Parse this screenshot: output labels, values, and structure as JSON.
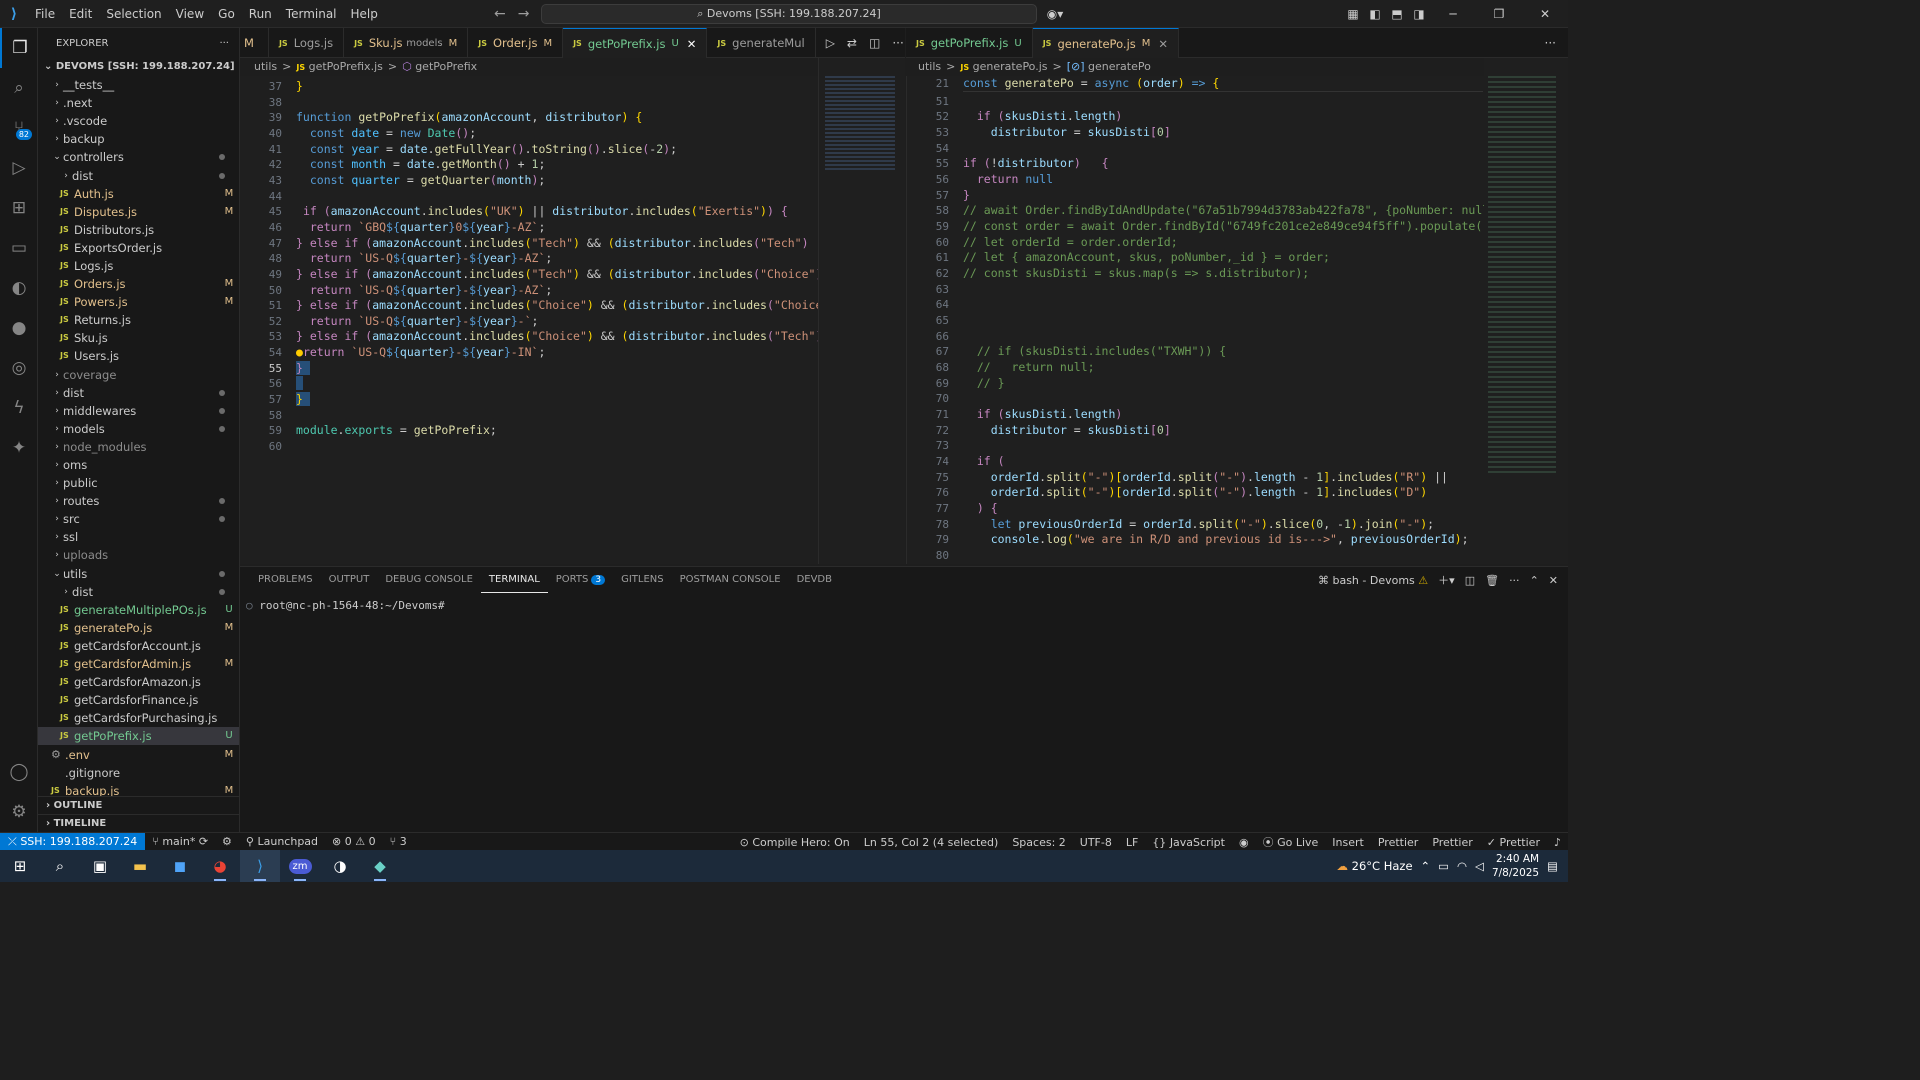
{
  "titlebar": {
    "menu": [
      "File",
      "Edit",
      "Selection",
      "View",
      "Go",
      "Run",
      "Terminal",
      "Help"
    ],
    "command_center": "Devoms [SSH: 199.188.207.24]"
  },
  "activity": {
    "scm_badge": "82"
  },
  "explorer": {
    "title": "EXPLORER",
    "root": "DEVOMS [SSH: 199.188.207.24]",
    "items": [
      {
        "name": "__tests__",
        "type": "folder",
        "indent": 1,
        "open": false,
        "status": ""
      },
      {
        "name": ".next",
        "type": "folder",
        "indent": 1,
        "open": false,
        "status": ""
      },
      {
        "name": ".vscode",
        "type": "folder",
        "indent": 1,
        "open": false,
        "status": ""
      },
      {
        "name": "backup",
        "type": "folder",
        "indent": 1,
        "open": false,
        "status": ""
      },
      {
        "name": "controllers",
        "type": "folder",
        "indent": 1,
        "open": true,
        "status": "dot"
      },
      {
        "name": "dist",
        "type": "folder",
        "indent": 2,
        "open": false,
        "status": "dot"
      },
      {
        "name": "Auth.js",
        "type": "js",
        "indent": 2,
        "status": "M"
      },
      {
        "name": "Disputes.js",
        "type": "js",
        "indent": 2,
        "status": "M"
      },
      {
        "name": "Distributors.js",
        "type": "js",
        "indent": 2,
        "status": ""
      },
      {
        "name": "ExportsOrder.js",
        "type": "js",
        "indent": 2,
        "status": ""
      },
      {
        "name": "Logs.js",
        "type": "js",
        "indent": 2,
        "status": ""
      },
      {
        "name": "Orders.js",
        "type": "js",
        "indent": 2,
        "status": "M"
      },
      {
        "name": "Powers.js",
        "type": "js",
        "indent": 2,
        "status": "M"
      },
      {
        "name": "Returns.js",
        "type": "js",
        "indent": 2,
        "status": ""
      },
      {
        "name": "Sku.js",
        "type": "js",
        "indent": 2,
        "status": ""
      },
      {
        "name": "Users.js",
        "type": "js",
        "indent": 2,
        "status": ""
      },
      {
        "name": "coverage",
        "type": "folder",
        "indent": 1,
        "open": false,
        "status": "",
        "dim": true
      },
      {
        "name": "dist",
        "type": "folder",
        "indent": 1,
        "open": false,
        "status": "dot"
      },
      {
        "name": "middlewares",
        "type": "folder",
        "indent": 1,
        "open": false,
        "status": "dot"
      },
      {
        "name": "models",
        "type": "folder",
        "indent": 1,
        "open": false,
        "status": "dot"
      },
      {
        "name": "node_modules",
        "type": "folder",
        "indent": 1,
        "open": false,
        "status": "",
        "dim": true
      },
      {
        "name": "oms",
        "type": "folder",
        "indent": 1,
        "open": false,
        "status": ""
      },
      {
        "name": "public",
        "type": "folder",
        "indent": 1,
        "open": false,
        "status": ""
      },
      {
        "name": "routes",
        "type": "folder",
        "indent": 1,
        "open": false,
        "status": "dot"
      },
      {
        "name": "src",
        "type": "folder",
        "indent": 1,
        "open": false,
        "status": "dot"
      },
      {
        "name": "ssl",
        "type": "folder",
        "indent": 1,
        "open": false,
        "status": ""
      },
      {
        "name": "uploads",
        "type": "folder",
        "indent": 1,
        "open": false,
        "status": "",
        "dim": true
      },
      {
        "name": "utils",
        "type": "folder",
        "indent": 1,
        "open": true,
        "status": "dot"
      },
      {
        "name": "dist",
        "type": "folder",
        "indent": 2,
        "open": false,
        "status": "dot"
      },
      {
        "name": "generateMultiplePOs.js",
        "type": "js",
        "indent": 2,
        "status": "U"
      },
      {
        "name": "generatePo.js",
        "type": "js",
        "indent": 2,
        "status": "M"
      },
      {
        "name": "getCardsforAccount.js",
        "type": "js",
        "indent": 2,
        "status": ""
      },
      {
        "name": "getCardsforAdmin.js",
        "type": "js",
        "indent": 2,
        "status": "M"
      },
      {
        "name": "getCardsforAmazon.js",
        "type": "js",
        "indent": 2,
        "status": ""
      },
      {
        "name": "getCardsforFinance.js",
        "type": "js",
        "indent": 2,
        "status": ""
      },
      {
        "name": "getCardsforPurchasing.js",
        "type": "js",
        "indent": 2,
        "status": ""
      },
      {
        "name": "getPoPrefix.js",
        "type": "js",
        "indent": 2,
        "status": "U",
        "selected": true
      },
      {
        "name": ".env",
        "type": "gear",
        "indent": 1,
        "status": "M"
      },
      {
        "name": ".gitignore",
        "type": "plain",
        "indent": 1,
        "status": ""
      },
      {
        "name": "backup.js",
        "type": "js",
        "indent": 1,
        "status": "M"
      }
    ],
    "outline": "OUTLINE",
    "timeline": "TIMELINE"
  },
  "tabs_left": [
    {
      "label": "M",
      "cls": "partial"
    },
    {
      "label": "Logs.js",
      "mark": "",
      "cls": ""
    },
    {
      "label": "Sku.js",
      "extra": "models",
      "mark": "M",
      "cls": "M"
    },
    {
      "label": "Order.js",
      "mark": "M",
      "cls": "M"
    },
    {
      "label": "getPoPrefix.js",
      "mark": "U",
      "cls": "U active",
      "close": true
    },
    {
      "label": "generateMul",
      "mark": "",
      "cls": ""
    }
  ],
  "tabs_right": [
    {
      "label": "getPoPrefix.js",
      "mark": "U",
      "cls": "U"
    },
    {
      "label": "generatePo.js",
      "mark": "M",
      "cls": "M active",
      "close": true
    }
  ],
  "breadcrumb_left": [
    "utils",
    ">",
    "getPoPrefix.js",
    ">",
    "getPoPrefix"
  ],
  "breadcrumb_right": [
    "utils",
    ">",
    "generatePo.js",
    ">",
    "generatePo"
  ],
  "panel": {
    "tabs": [
      "PROBLEMS",
      "OUTPUT",
      "DEBUG CONSOLE",
      "TERMINAL",
      "PORTS",
      "GITLENS",
      "POSTMAN CONSOLE",
      "DEVDB"
    ],
    "ports_badge": "3",
    "shell": "bash - Devoms",
    "prompt": "root@nc-ph-1564-48:~/Devoms#"
  },
  "status": {
    "remote": "SSH: 199.188.207.24",
    "branch": "main*",
    "launchpad": "Launchpad",
    "errors": "0",
    "warnings": "0",
    "ports": "3",
    "compile": "Compile Hero: On",
    "position": "Ln 55, Col 2 (4 selected)",
    "spaces": "Spaces: 2",
    "encoding": "UTF-8",
    "eol": "LF",
    "language": "JavaScript",
    "golive": "Go Live",
    "insert": "Insert",
    "prettier1": "Prettier",
    "prettier2": "Prettier",
    "prettier3": "Prettier"
  },
  "taskbar": {
    "weather": "26°C Haze",
    "time": "2:40 AM",
    "date": "7/8/2025",
    "notifications": "1"
  }
}
